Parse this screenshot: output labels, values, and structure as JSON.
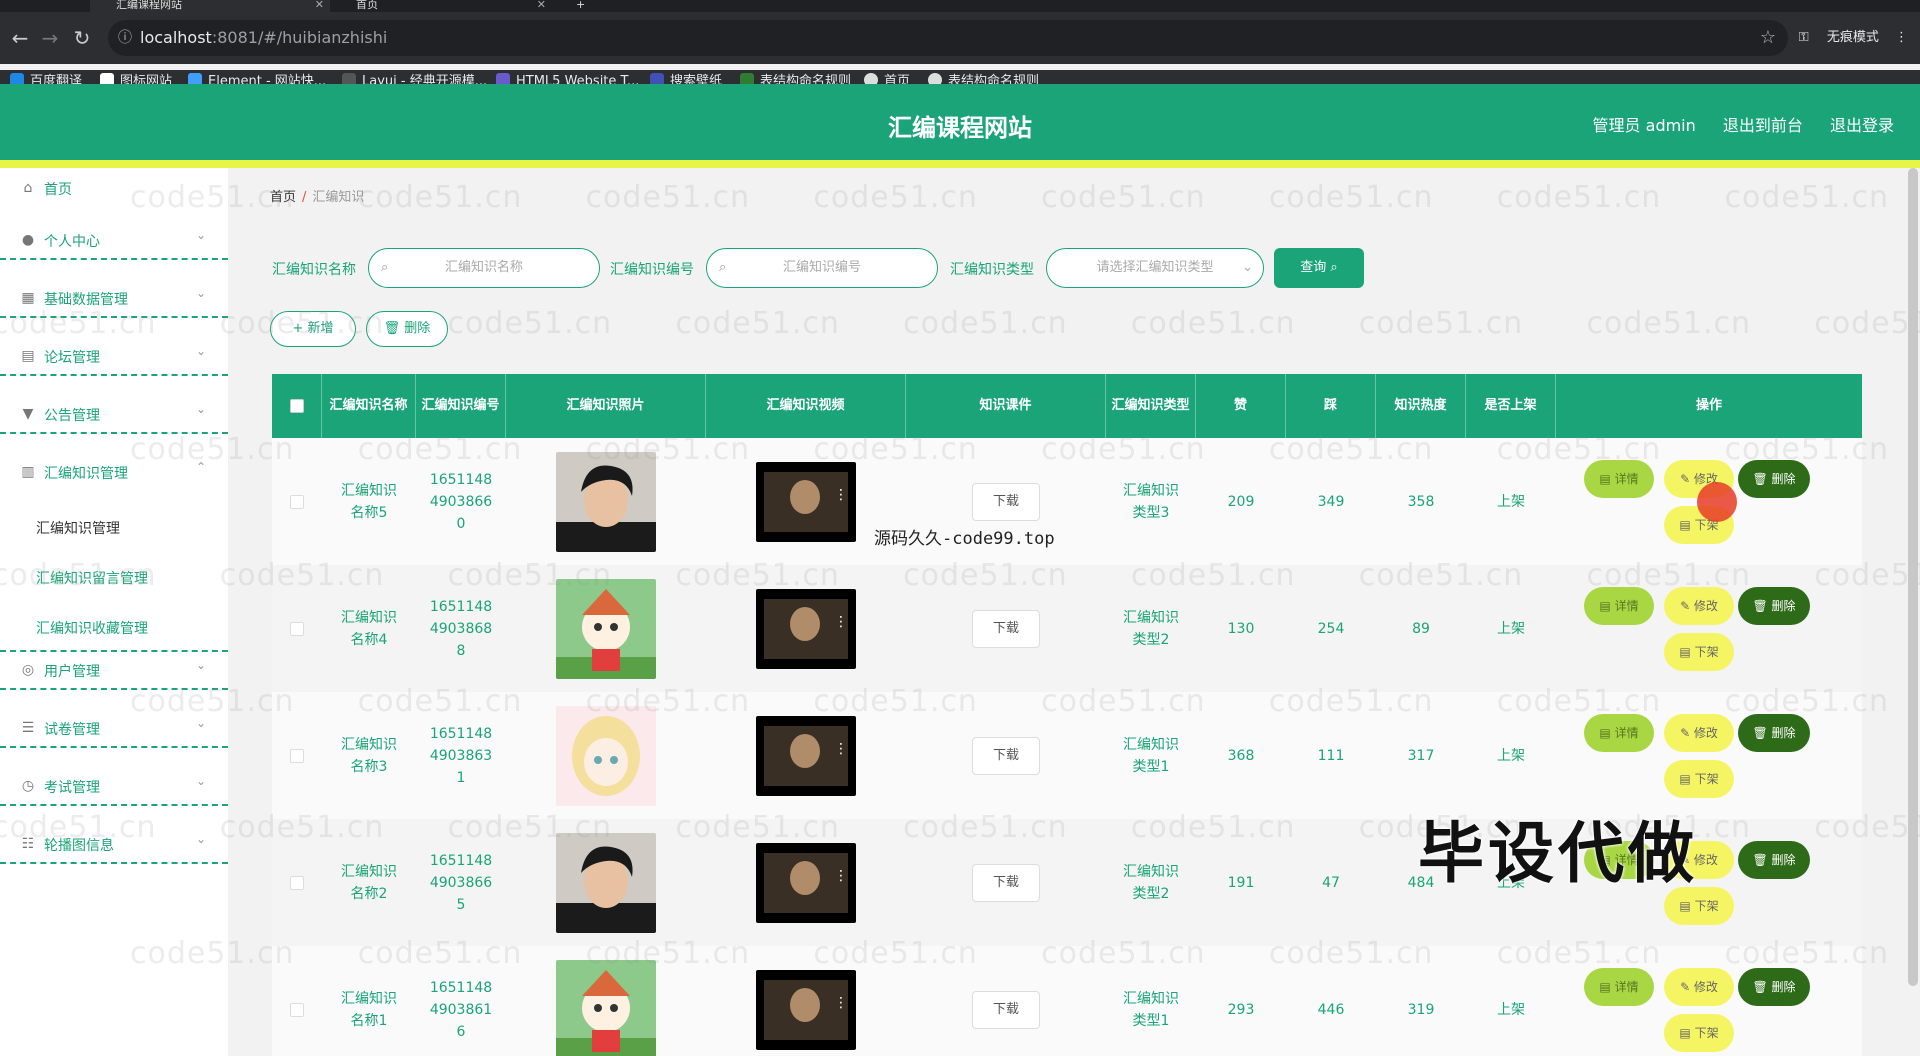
{
  "browser": {
    "tabs": [
      {
        "title": "汇编课程网站",
        "active": true
      },
      {
        "title": "首页",
        "active": false
      }
    ],
    "url_host": "localhost",
    "url_rest": ":8081/#/huibianzhishi",
    "profile": "无痕模式",
    "bookmarks": [
      "百度翻译",
      "图标网站",
      "Element - 网站快...",
      "Layui - 经典开源模...",
      "HTML5 Website T...",
      "搜索壁纸",
      "表结构命名规则",
      "首页",
      "表结构命名规则"
    ]
  },
  "header": {
    "title": "汇编课程网站",
    "admin": "管理员 admin",
    "back": "退出到前台",
    "logout": "退出登录"
  },
  "sidebar": {
    "items": [
      {
        "label": "首页",
        "icon": "home-icon"
      },
      {
        "label": "个人中心",
        "icon": "user-icon"
      },
      {
        "label": "基础数据管理",
        "icon": "data-icon"
      },
      {
        "label": "论坛管理",
        "icon": "forum-icon"
      },
      {
        "label": "公告管理",
        "icon": "notice-icon"
      },
      {
        "label": "汇编知识管理",
        "icon": "knowledge-icon"
      },
      {
        "label": "用户管理",
        "icon": "users-icon"
      },
      {
        "label": "试卷管理",
        "icon": "list-icon"
      },
      {
        "label": "考试管理",
        "icon": "clock-icon"
      },
      {
        "label": "轮播图信息",
        "icon": "sliders-icon"
      }
    ],
    "sub_items": [
      "汇编知识管理",
      "汇编知识留言管理",
      "汇编知识收藏管理"
    ]
  },
  "breadcrumb": {
    "home": "首页",
    "sep": "/",
    "current": "汇编知识"
  },
  "search": {
    "name_label": "汇编知识名称",
    "name_placeholder": "汇编知识名称",
    "code_label": "汇编知识编号",
    "code_placeholder": "汇编知识编号",
    "type_label": "汇编知识类型",
    "type_placeholder": "请选择汇编知识类型",
    "query_btn": "查询 ⌕"
  },
  "actions": {
    "add": "+ 新增",
    "delete": "🗑 删除"
  },
  "table": {
    "columns": [
      "汇编知识名称",
      "汇编知识编号",
      "汇编知识照片",
      "汇编知识视频",
      "知识课件",
      "汇编知识类型",
      "赞",
      "踩",
      "知识热度",
      "是否上架",
      "操作"
    ],
    "download_label": "下载",
    "detail_label": "详情",
    "edit_label": "修改",
    "delete_label": "删除",
    "off_label": "下架",
    "rows": [
      {
        "name": "汇编知识名称5",
        "code": "165114849038660",
        "photo": "avatar-man",
        "type": "汇编知识类型3",
        "like": "209",
        "dislike": "349",
        "heat": "358",
        "status": "上架"
      },
      {
        "name": "汇编知识名称4",
        "code": "165114849038688",
        "photo": "avatar-fox",
        "type": "汇编知识类型2",
        "like": "130",
        "dislike": "254",
        "heat": "89",
        "status": "上架"
      },
      {
        "name": "汇编知识名称3",
        "code": "165114849038631",
        "photo": "avatar-anime",
        "type": "汇编知识类型1",
        "like": "368",
        "dislike": "111",
        "heat": "317",
        "status": "上架"
      },
      {
        "name": "汇编知识名称2",
        "code": "165114849038665",
        "photo": "avatar-man",
        "type": "汇编知识类型2",
        "like": "191",
        "dislike": "47",
        "heat": "484",
        "status": "上架"
      },
      {
        "name": "汇编知识名称1",
        "code": "165114849038616",
        "photo": "avatar-fox",
        "type": "汇编知识类型1",
        "like": "293",
        "dislike": "446",
        "heat": "319",
        "status": "上架"
      }
    ]
  },
  "overlays": {
    "watermark": "code51.cn",
    "source_tag": "源码久久-code99.top",
    "promo": "毕设代做"
  },
  "colors": {
    "primary": "#1aa477",
    "stripe": "#e7f548",
    "detail": "#a8d743",
    "edit": "#f5f563",
    "danger": "#2e6b18"
  }
}
